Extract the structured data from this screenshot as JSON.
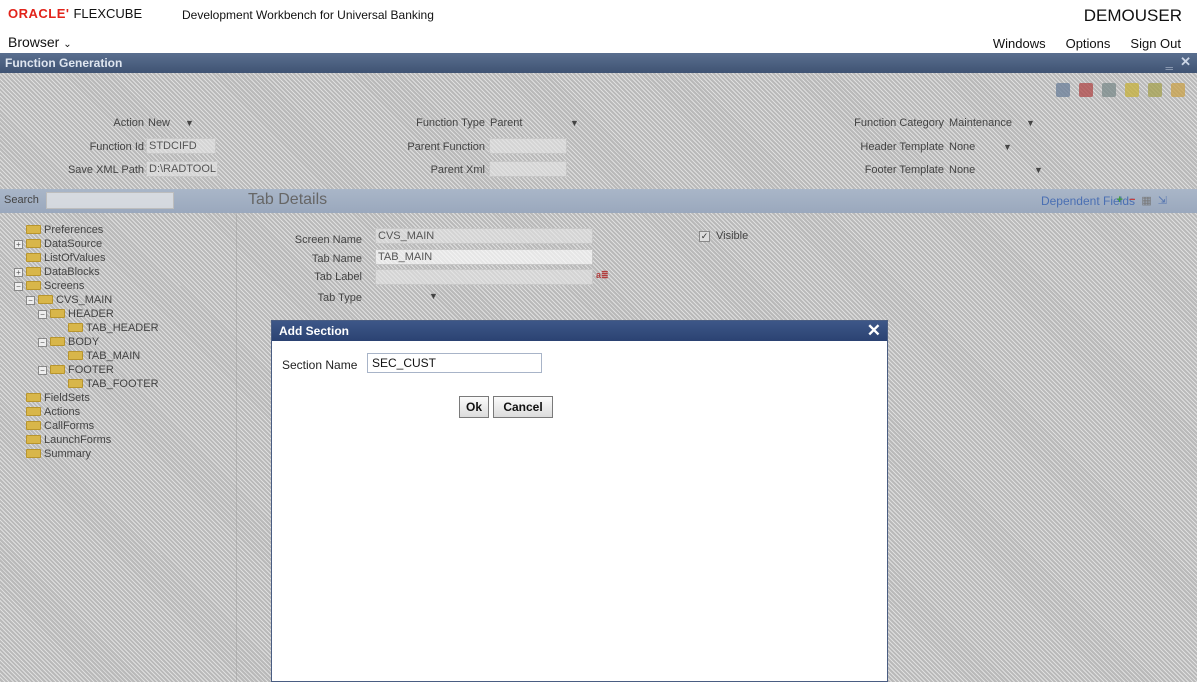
{
  "header": {
    "brand": "ORACLE'",
    "product": "FLEXCUBE",
    "subtitle": "Development Workbench for Universal Banking",
    "user": "DEMOUSER",
    "browser_menu": "Browser",
    "links": [
      "Windows",
      "Options",
      "Sign Out"
    ]
  },
  "window": {
    "title": "Function Generation",
    "form": {
      "action_label": "Action",
      "action_value": "New",
      "function_id_label": "Function Id",
      "function_id_value": "STDCIFD",
      "save_xml_label": "Save XML Path",
      "save_xml_value": "D:\\RADTOOL",
      "function_type_label": "Function Type",
      "function_type_value": "Parent",
      "parent_function_label": "Parent Function",
      "parent_xml_label": "Parent Xml",
      "function_category_label": "Function Category",
      "function_category_value": "Maintenance",
      "header_template_label": "Header Template",
      "header_template_value": "None",
      "footer_template_label": "Footer Template",
      "footer_template_value": "None"
    },
    "search_label": "Search",
    "tab_details": "Tab Details",
    "dependent_fields": "Dependent Fields",
    "tree": [
      "Preferences",
      "DataSource",
      "ListOfValues",
      "DataBlocks",
      "Screens",
      "CVS_MAIN",
      "HEADER",
      "TAB_HEADER",
      "BODY",
      "TAB_MAIN",
      "FOOTER",
      "TAB_FOOTER",
      "FieldSets",
      "Actions",
      "CallForms",
      "LaunchForms",
      "Summary"
    ],
    "tab_form": {
      "screen_name_label": "Screen Name",
      "screen_name_value": "CVS_MAIN",
      "tab_name_label": "Tab Name",
      "tab_name_value": "TAB_MAIN",
      "tab_label_label": "Tab Label",
      "tab_type_label": "Tab Type",
      "visible_label": "Visible"
    }
  },
  "modal": {
    "title": "Add Section",
    "close_glyph": "✕",
    "section_name_label": "Section Name",
    "section_name_value": "SEC_CUST",
    "ok_label": "Ok",
    "cancel_label": "Cancel"
  }
}
